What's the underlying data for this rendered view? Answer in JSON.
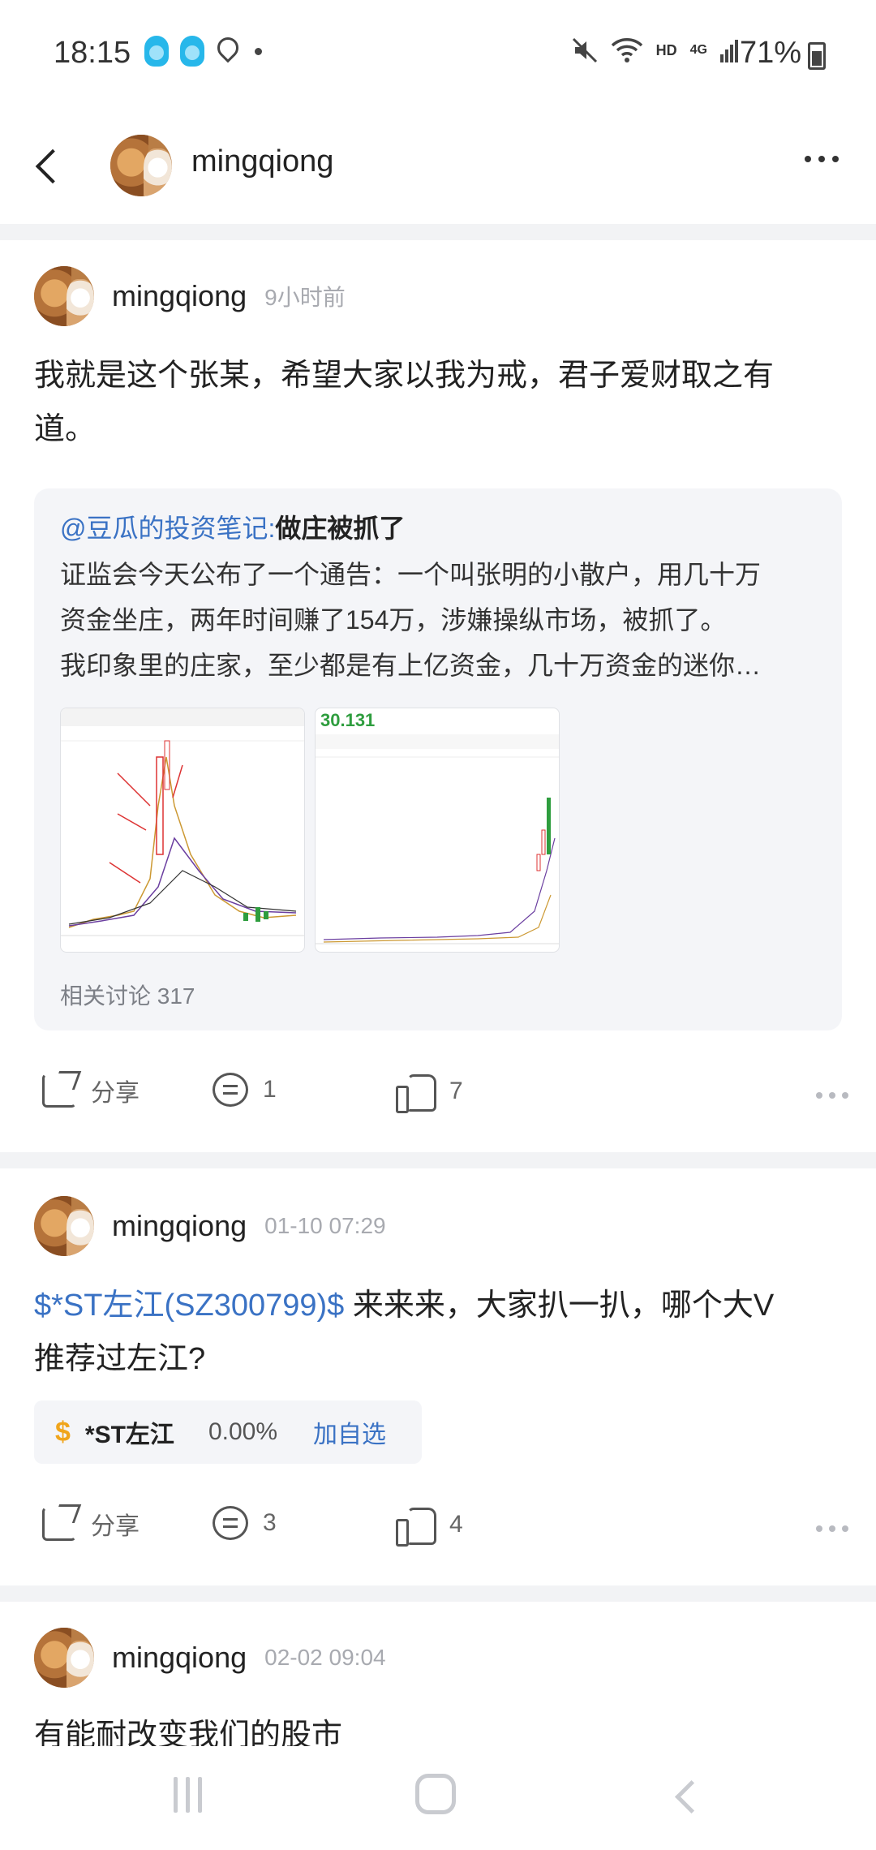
{
  "status_bar": {
    "time": "18:15",
    "network": "HD",
    "signal": "4G",
    "battery": "71%"
  },
  "header": {
    "title": "mingqiong"
  },
  "posts": [
    {
      "author": "mingqiong",
      "time": "9小时前",
      "text_line1": "我就是这个张某，希望大家以我为戒，君子爱财取之有",
      "text_line2": "道。",
      "quote": {
        "mention": "@豆瓜的投资笔记:",
        "title": "做庄被抓了",
        "body_line1": "证监会今天公布了一个通告：一个叫张明的小散户，用几十万",
        "body_line2": "资金坐庄，两年时间赚了154万，涉嫌操纵市场，被抓了。",
        "body_line3": "我印象里的庄家，至少都是有上亿资金，几十万资金的迷你…",
        "image2_price": "30.131",
        "discussion": "相关讨论 317"
      },
      "share_label": "分享",
      "comments": "1",
      "likes": "7"
    },
    {
      "author": "mingqiong",
      "time": "01-10 07:29",
      "stock_link": "$*ST左江(SZ300799)$",
      "text_part1": " 来来来，大家扒一扒，哪个大V",
      "text_line2": "推荐过左江?",
      "stock": {
        "symbol": "$",
        "name": "*ST左江",
        "change": "0.00%",
        "action": "加自选"
      },
      "share_label": "分享",
      "comments": "3",
      "likes": "4"
    },
    {
      "author": "mingqiong",
      "time": "02-02 09:04",
      "text_line1": "有能耐改变我们的股市"
    }
  ],
  "colors": {
    "link": "#3a72c4",
    "separator": "#f2f3f5",
    "quote_bg": "#f4f5f8"
  }
}
